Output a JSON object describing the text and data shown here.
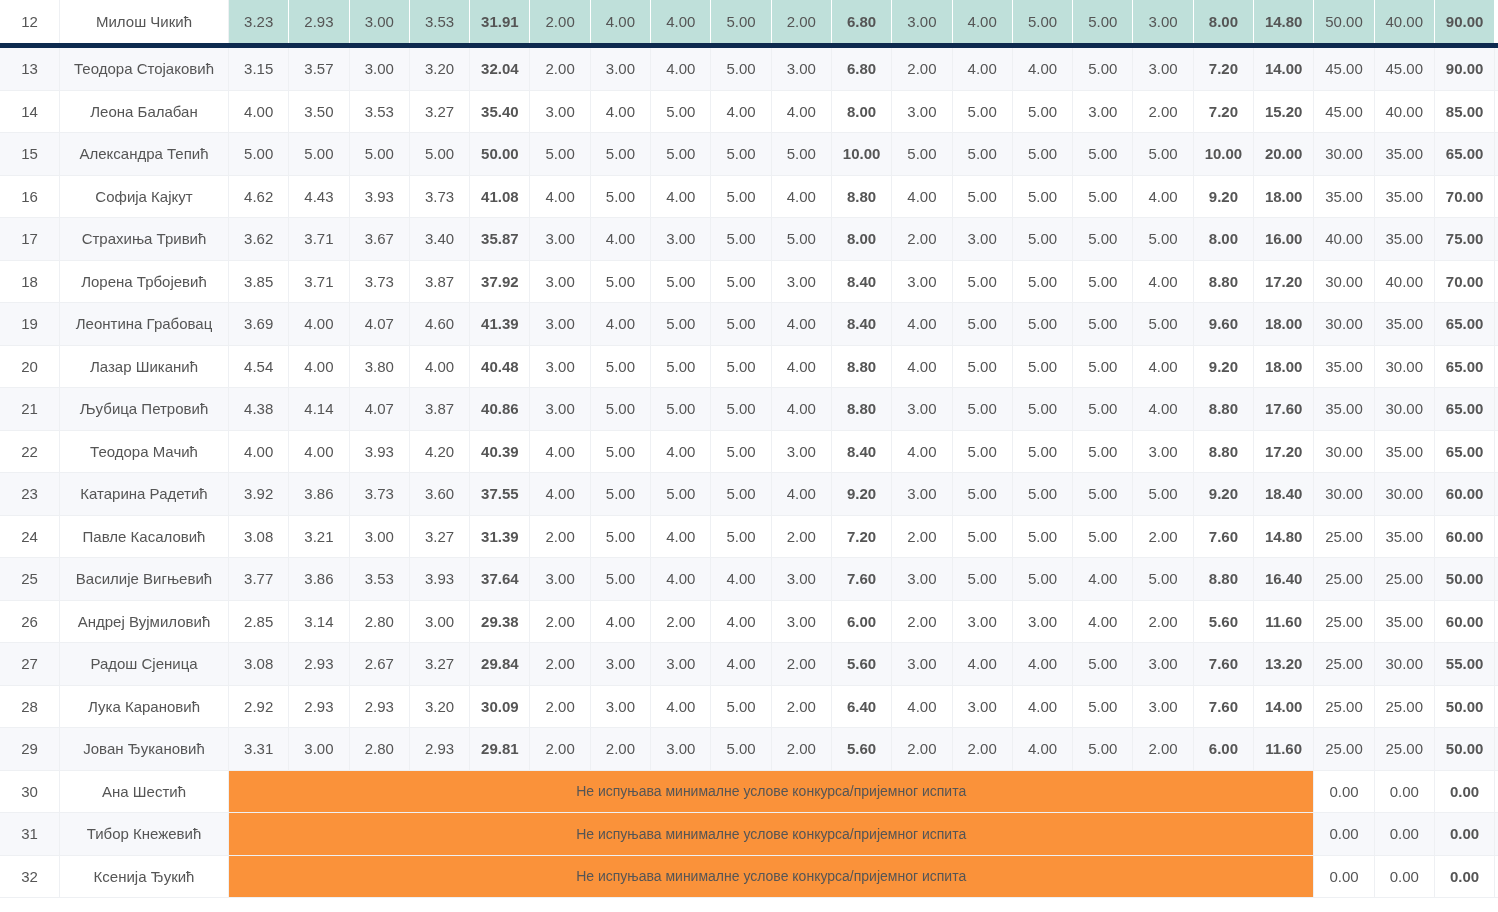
{
  "rows": [
    {
      "number": "12",
      "name": "Милош Чикић",
      "selected": true,
      "kind": "scored",
      "values": [
        "3.23",
        "2.93",
        "3.00",
        "3.53",
        "31.91",
        "2.00",
        "4.00",
        "4.00",
        "5.00",
        "2.00",
        "6.80",
        "3.00",
        "4.00",
        "5.00",
        "5.00",
        "3.00",
        "8.00",
        "14.80",
        "50.00",
        "40.00",
        "90.00"
      ]
    },
    {
      "number": "13",
      "name": "Теодора Стојаковић",
      "selected": false,
      "kind": "scored",
      "values": [
        "3.15",
        "3.57",
        "3.00",
        "3.20",
        "32.04",
        "2.00",
        "3.00",
        "4.00",
        "5.00",
        "3.00",
        "6.80",
        "2.00",
        "4.00",
        "4.00",
        "5.00",
        "3.00",
        "7.20",
        "14.00",
        "45.00",
        "45.00",
        "90.00"
      ]
    },
    {
      "number": "14",
      "name": "Леона Балабан",
      "selected": false,
      "kind": "scored",
      "values": [
        "4.00",
        "3.50",
        "3.53",
        "3.27",
        "35.40",
        "3.00",
        "4.00",
        "5.00",
        "4.00",
        "4.00",
        "8.00",
        "3.00",
        "5.00",
        "5.00",
        "3.00",
        "2.00",
        "7.20",
        "15.20",
        "45.00",
        "40.00",
        "85.00"
      ]
    },
    {
      "number": "15",
      "name": "Александра Тепић",
      "selected": false,
      "kind": "scored",
      "values": [
        "5.00",
        "5.00",
        "5.00",
        "5.00",
        "50.00",
        "5.00",
        "5.00",
        "5.00",
        "5.00",
        "5.00",
        "10.00",
        "5.00",
        "5.00",
        "5.00",
        "5.00",
        "5.00",
        "10.00",
        "20.00",
        "30.00",
        "35.00",
        "65.00"
      ]
    },
    {
      "number": "16",
      "name": "Софија Кајкут",
      "selected": false,
      "kind": "scored",
      "values": [
        "4.62",
        "4.43",
        "3.93",
        "3.73",
        "41.08",
        "4.00",
        "5.00",
        "4.00",
        "5.00",
        "4.00",
        "8.80",
        "4.00",
        "5.00",
        "5.00",
        "5.00",
        "4.00",
        "9.20",
        "18.00",
        "35.00",
        "35.00",
        "70.00"
      ]
    },
    {
      "number": "17",
      "name": "Страхиња Тривић",
      "selected": false,
      "kind": "scored",
      "values": [
        "3.62",
        "3.71",
        "3.67",
        "3.40",
        "35.87",
        "3.00",
        "4.00",
        "3.00",
        "5.00",
        "5.00",
        "8.00",
        "2.00",
        "3.00",
        "5.00",
        "5.00",
        "5.00",
        "8.00",
        "16.00",
        "40.00",
        "35.00",
        "75.00"
      ]
    },
    {
      "number": "18",
      "name": "Лорена Трбојевић",
      "selected": false,
      "kind": "scored",
      "values": [
        "3.85",
        "3.71",
        "3.73",
        "3.87",
        "37.92",
        "3.00",
        "5.00",
        "5.00",
        "5.00",
        "3.00",
        "8.40",
        "3.00",
        "5.00",
        "5.00",
        "5.00",
        "4.00",
        "8.80",
        "17.20",
        "30.00",
        "40.00",
        "70.00"
      ]
    },
    {
      "number": "19",
      "name": "Леонтина Грабовац",
      "selected": false,
      "kind": "scored",
      "values": [
        "3.69",
        "4.00",
        "4.07",
        "4.60",
        "41.39",
        "3.00",
        "4.00",
        "5.00",
        "5.00",
        "4.00",
        "8.40",
        "4.00",
        "5.00",
        "5.00",
        "5.00",
        "5.00",
        "9.60",
        "18.00",
        "30.00",
        "35.00",
        "65.00"
      ]
    },
    {
      "number": "20",
      "name": "Лазар Шиканић",
      "selected": false,
      "kind": "scored",
      "values": [
        "4.54",
        "4.00",
        "3.80",
        "4.00",
        "40.48",
        "3.00",
        "5.00",
        "5.00",
        "5.00",
        "4.00",
        "8.80",
        "4.00",
        "5.00",
        "5.00",
        "5.00",
        "4.00",
        "9.20",
        "18.00",
        "35.00",
        "30.00",
        "65.00"
      ]
    },
    {
      "number": "21",
      "name": "Љубица Петровић",
      "selected": false,
      "kind": "scored",
      "values": [
        "4.38",
        "4.14",
        "4.07",
        "3.87",
        "40.86",
        "3.00",
        "5.00",
        "5.00",
        "5.00",
        "4.00",
        "8.80",
        "3.00",
        "5.00",
        "5.00",
        "5.00",
        "4.00",
        "8.80",
        "17.60",
        "35.00",
        "30.00",
        "65.00"
      ]
    },
    {
      "number": "22",
      "name": "Теодора Мачић",
      "selected": false,
      "kind": "scored",
      "values": [
        "4.00",
        "4.00",
        "3.93",
        "4.20",
        "40.39",
        "4.00",
        "5.00",
        "4.00",
        "5.00",
        "3.00",
        "8.40",
        "4.00",
        "5.00",
        "5.00",
        "5.00",
        "3.00",
        "8.80",
        "17.20",
        "30.00",
        "35.00",
        "65.00"
      ]
    },
    {
      "number": "23",
      "name": "Катарина Радетић",
      "selected": false,
      "kind": "scored",
      "values": [
        "3.92",
        "3.86",
        "3.73",
        "3.60",
        "37.55",
        "4.00",
        "5.00",
        "5.00",
        "5.00",
        "4.00",
        "9.20",
        "3.00",
        "5.00",
        "5.00",
        "5.00",
        "5.00",
        "9.20",
        "18.40",
        "30.00",
        "30.00",
        "60.00"
      ]
    },
    {
      "number": "24",
      "name": "Павле Касаловић",
      "selected": false,
      "kind": "scored",
      "values": [
        "3.08",
        "3.21",
        "3.00",
        "3.27",
        "31.39",
        "2.00",
        "5.00",
        "4.00",
        "5.00",
        "2.00",
        "7.20",
        "2.00",
        "5.00",
        "5.00",
        "5.00",
        "2.00",
        "7.60",
        "14.80",
        "25.00",
        "35.00",
        "60.00"
      ]
    },
    {
      "number": "25",
      "name": "Василије Вигњевић",
      "selected": false,
      "kind": "scored",
      "values": [
        "3.77",
        "3.86",
        "3.53",
        "3.93",
        "37.64",
        "3.00",
        "5.00",
        "4.00",
        "4.00",
        "3.00",
        "7.60",
        "3.00",
        "5.00",
        "5.00",
        "4.00",
        "5.00",
        "8.80",
        "16.40",
        "25.00",
        "25.00",
        "50.00"
      ]
    },
    {
      "number": "26",
      "name": "Андреј Вујмиловић",
      "selected": false,
      "kind": "scored",
      "values": [
        "2.85",
        "3.14",
        "2.80",
        "3.00",
        "29.38",
        "2.00",
        "4.00",
        "2.00",
        "4.00",
        "3.00",
        "6.00",
        "2.00",
        "3.00",
        "3.00",
        "4.00",
        "2.00",
        "5.60",
        "11.60",
        "25.00",
        "35.00",
        "60.00"
      ]
    },
    {
      "number": "27",
      "name": "Радош Сјеница",
      "selected": false,
      "kind": "scored",
      "values": [
        "3.08",
        "2.93",
        "2.67",
        "3.27",
        "29.84",
        "2.00",
        "3.00",
        "3.00",
        "4.00",
        "2.00",
        "5.60",
        "3.00",
        "4.00",
        "4.00",
        "5.00",
        "3.00",
        "7.60",
        "13.20",
        "25.00",
        "30.00",
        "55.00"
      ]
    },
    {
      "number": "28",
      "name": "Лука Карановић",
      "selected": false,
      "kind": "scored",
      "values": [
        "2.92",
        "2.93",
        "2.93",
        "3.20",
        "30.09",
        "2.00",
        "3.00",
        "4.00",
        "5.00",
        "2.00",
        "6.40",
        "4.00",
        "3.00",
        "4.00",
        "5.00",
        "3.00",
        "7.60",
        "14.00",
        "25.00",
        "25.00",
        "50.00"
      ]
    },
    {
      "number": "29",
      "name": "Јован Ђукановић",
      "selected": false,
      "kind": "scored",
      "values": [
        "3.31",
        "3.00",
        "2.80",
        "2.93",
        "29.81",
        "2.00",
        "2.00",
        "3.00",
        "5.00",
        "2.00",
        "5.60",
        "2.00",
        "2.00",
        "4.00",
        "5.00",
        "2.00",
        "6.00",
        "11.60",
        "25.00",
        "25.00",
        "50.00"
      ]
    },
    {
      "number": "30",
      "name": "Ана Шестић",
      "selected": false,
      "kind": "disqualified",
      "message": "Не испуњава минималне услове конкурса/пријемног испита",
      "values": [
        "0.00",
        "0.00",
        "0.00"
      ]
    },
    {
      "number": "31",
      "name": "Тибор Кнежевић",
      "selected": false,
      "kind": "disqualified",
      "message": "Не испуњава минималне услове конкурса/пријемног испита",
      "values": [
        "0.00",
        "0.00",
        "0.00"
      ]
    },
    {
      "number": "32",
      "name": "Ксенија Ђукић",
      "selected": false,
      "kind": "disqualified",
      "message": "Не испуњава минималне услове конкурса/пријемног испита",
      "values": [
        "0.00",
        "0.00",
        "0.00"
      ]
    }
  ]
}
